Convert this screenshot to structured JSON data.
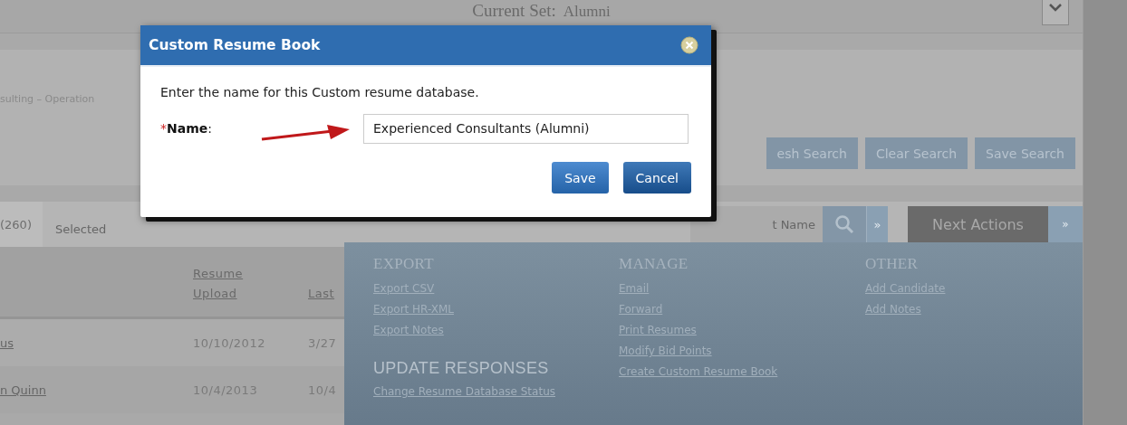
{
  "page": {
    "current_set": {
      "label": "Current Set:",
      "value": "Alumni"
    },
    "breadcrumb": "sulting – Operation",
    "search_buttons": [
      "esh Search",
      "Clear Search",
      "Save Search"
    ],
    "tabs": [
      {
        "label": "(260)",
        "selected": true
      },
      {
        "label": "Selected",
        "selected": false
      }
    ],
    "name_search": {
      "placeholder": "t Name",
      "search_more": "»"
    },
    "next_actions": {
      "label": "Next Actions",
      "expanded": true,
      "more": "»"
    },
    "table": {
      "columns": [
        "Resume Upload",
        "Last"
      ],
      "rows": [
        {
          "name": "us",
          "cells": [
            "10/10/2012",
            "3/27"
          ]
        },
        {
          "name": "n Quinn",
          "cells": [
            "10/4/2013",
            "10/4"
          ]
        }
      ]
    }
  },
  "menu": {
    "columns": [
      [
        {
          "title": "EXPORT",
          "items": [
            "Export CSV",
            "Export HR-XML",
            "Export Notes"
          ]
        },
        {
          "title": "UPDATE RESPONSES",
          "items": [
            "Change Resume Database Status"
          ]
        }
      ],
      [
        {
          "title": "MANAGE",
          "items": [
            "Email",
            "Forward",
            "Print Resumes",
            "Modify Bid Points",
            "Create Custom Resume Book"
          ]
        }
      ],
      [
        {
          "title": "OTHER",
          "items": [
            "Add Candidate",
            "Add Notes"
          ]
        }
      ]
    ]
  },
  "dialog": {
    "title": "Custom Resume Book",
    "message": "Enter the name for this Custom resume database.",
    "field": {
      "required_mark": "*",
      "label": "**Name**:",
      "value": "Experienced Consultants (Alumni)"
    },
    "buttons": [
      "Save",
      "Cancel"
    ]
  }
}
